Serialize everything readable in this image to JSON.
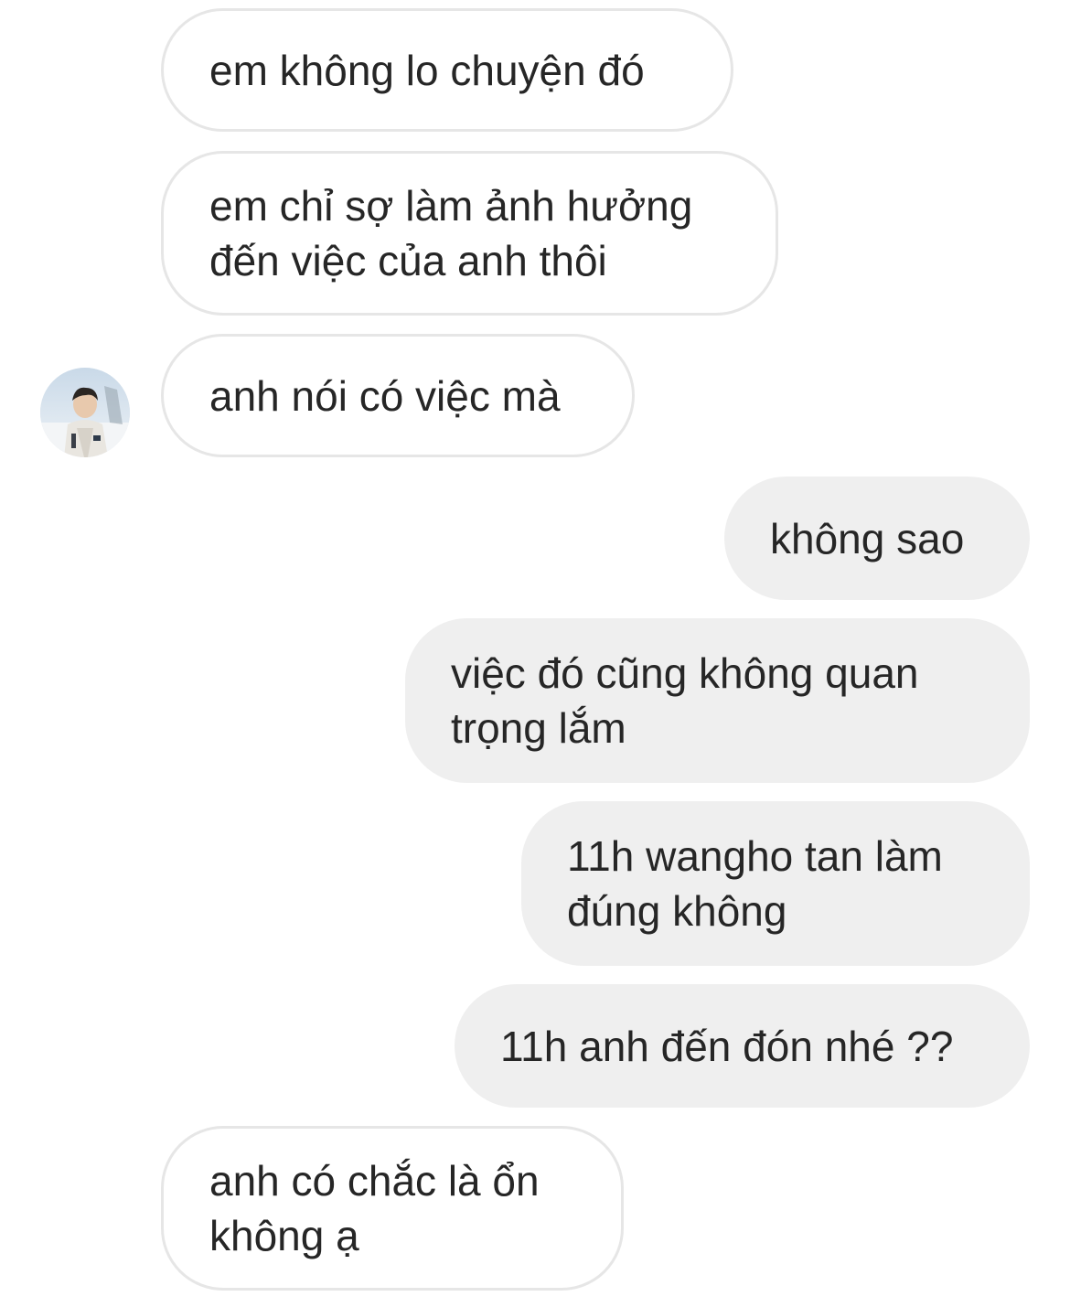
{
  "conversation": {
    "messages": [
      {
        "sender": "them",
        "text": "em không lo chuyện đó"
      },
      {
        "sender": "them",
        "text": "em chỉ sợ làm ảnh hưởng\nđến việc của anh thôi"
      },
      {
        "sender": "them",
        "text": "anh nói có việc mà"
      },
      {
        "sender": "me",
        "text": "không sao"
      },
      {
        "sender": "me",
        "text": "việc đó cũng không quan\ntrọng lắm"
      },
      {
        "sender": "me",
        "text": "11h wangho tan làm\nđúng không"
      },
      {
        "sender": "me",
        "text": "11h anh đến đón nhé ??"
      },
      {
        "sender": "them",
        "text": "anh có chắc là ổn\nkhông ạ"
      }
    ]
  },
  "contact": {
    "avatar_icon": "profile-photo"
  },
  "colors": {
    "sent_bubble": "#efefef",
    "received_border": "#e6e6e6",
    "text": "#262626",
    "background": "#ffffff"
  }
}
